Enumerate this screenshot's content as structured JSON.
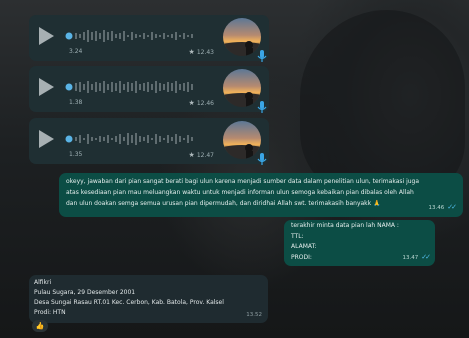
{
  "voice_messages": [
    {
      "duration": "3.24",
      "time": "12.43"
    },
    {
      "duration": "1.38",
      "time": "12.46"
    },
    {
      "duration": "1.35",
      "time": "12.47"
    }
  ],
  "out_message_1": {
    "line1": "okeyy, jawaban dari pian sangat berati bagi ulun karena menjadi sumber data dalam penelitian ulun, terimakasi juga",
    "line2": "atas kesediaan pian mau meluangkan waktu untuk menjadi informan ulun semoga kebaikan pian dibalas oleh Allah",
    "line3": "dan ulun doakan semga semua urusan pian dipermudah, dan diridhai Allah swt. terimakasih banyakk 🙏",
    "time": "13.46"
  },
  "out_message_2": {
    "line1": "terakhir minta data pian lah NAMA :",
    "line2": "TTL:",
    "line3": "ALAMAT:",
    "line4": "PRODI:",
    "time": "13.47"
  },
  "in_message": {
    "line1": "Alfikri",
    "line2": "Pulau Sugara, 29 Desember 2001",
    "line3": "Desa Sungai Rasau RT.01 Kec. Cerbon, Kab. Batola, Prov. Kalsel",
    "line4": "Prodi: HTN",
    "time": "13.52",
    "reaction": "👍"
  },
  "colors": {
    "outgoing_bubble": "#0c4d45",
    "incoming_bubble": "#1f2b30",
    "read_ticks": "#53bdeb",
    "mic_icon": "#3aa6e6"
  },
  "icons": [
    "play-icon",
    "star-icon",
    "mic-icon",
    "double-check-icon",
    "thumbs-up-icon"
  ]
}
